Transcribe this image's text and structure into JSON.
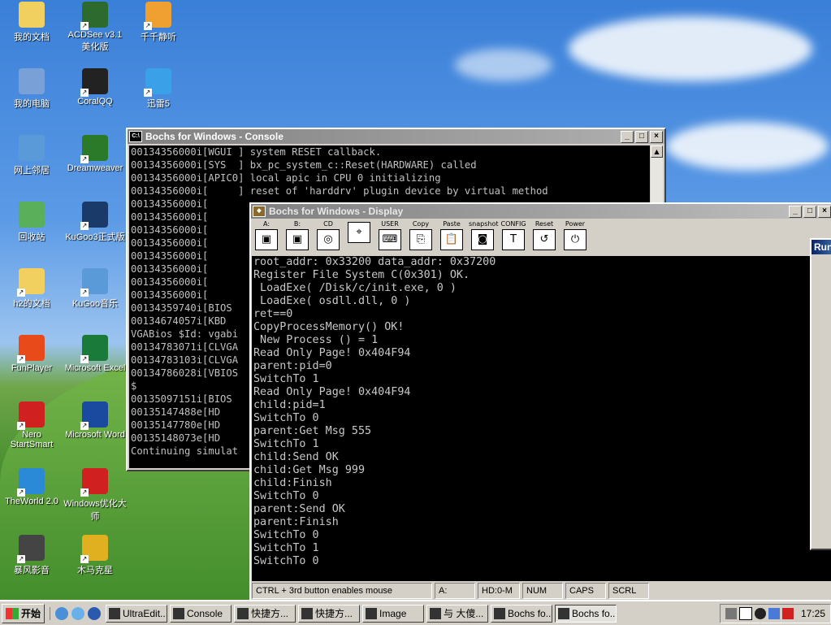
{
  "desktop": {
    "icons": [
      {
        "label": "我的文档",
        "icon": "my-documents-folder-icon",
        "color": "#f2d060"
      },
      {
        "label": "ACDSee v3.1 美化版",
        "icon": "acdsee-icon",
        "color": "#2d6a2d"
      },
      {
        "label": "千千静听",
        "icon": "ttplayer-icon",
        "color": "#f0a030"
      },
      {
        "label": "我的电脑",
        "icon": "my-computer-icon",
        "color": "#7aa0d8"
      },
      {
        "label": "CoralQQ",
        "icon": "qq-penguin-icon",
        "color": "#222222"
      },
      {
        "label": "迅雷5",
        "icon": "thunder-icon",
        "color": "#3aa0e8"
      },
      {
        "label": "网上邻居",
        "icon": "network-places-icon",
        "color": "#5a9ad8"
      },
      {
        "label": "Dreamweaver",
        "icon": "dreamweaver-icon",
        "color": "#2a7a2a"
      },
      {
        "label": "回收站",
        "icon": "recycle-bin-icon",
        "color": "#5ab05a"
      },
      {
        "label": "KuGoo3正式版",
        "icon": "kugoo-icon",
        "color": "#1a3a6a"
      },
      {
        "label": "h2的文档",
        "icon": "h2-documents-folder-icon",
        "color": "#f2d060"
      },
      {
        "label": "KuGoo音乐",
        "icon": "kugoo-music-icon",
        "color": "#5a9ad8"
      },
      {
        "label": "FunPlayer",
        "icon": "funplayer-icon",
        "color": "#e84a1a"
      },
      {
        "label": "Microsoft Excel",
        "icon": "excel-icon",
        "color": "#1a7a3a"
      },
      {
        "label": "Nero StartSmart",
        "icon": "nero-icon",
        "color": "#d02020"
      },
      {
        "label": "Microsoft Word",
        "icon": "word-icon",
        "color": "#1a4aa0"
      },
      {
        "label": "TheWorld 2.0",
        "icon": "theworld-browser-icon",
        "color": "#2a8ad8"
      },
      {
        "label": "Windows优化大师",
        "icon": "windows-optimizer-icon",
        "color": "#d02020"
      },
      {
        "label": "暴风影音",
        "icon": "storm-player-icon",
        "color": "#444444"
      },
      {
        "label": "木马克星",
        "icon": "trojan-killer-icon",
        "color": "#e0b020"
      }
    ]
  },
  "console": {
    "title": "Bochs for Windows - Console",
    "lines": [
      "00134356000i[WGUI ] system RESET callback.",
      "00134356000i[SYS  ] bx_pc_system_c::Reset(HARDWARE) called",
      "00134356000i[APIC0] local apic in CPU 0 initializing",
      "00134356000i[     ] reset of 'harddrv' plugin device by virtual method",
      "00134356000i[",
      "00134356000i[",
      "00134356000i[",
      "00134356000i[",
      "00134356000i[",
      "00134356000i[",
      "00134356000i[",
      "00134356000i[",
      "00134359740i[BIOS",
      "00134674057i[KBD",
      "VGABios $Id: vgabi",
      "00134783071i[CLVGA",
      "00134783103i[CLVGA",
      "00134786028i[VBIOS",
      "$",
      "00135097151i[BIOS",
      "00135147488e[HD",
      "00135147780e[HD",
      "00135148073e[HD",
      "Continuing simulat"
    ]
  },
  "display": {
    "title": "Bochs for Windows - Display",
    "toolbar": [
      {
        "label": "A:",
        "icon": "floppy-a-icon",
        "glyph": "▣"
      },
      {
        "label": "B:",
        "icon": "floppy-b-icon",
        "glyph": "▣"
      },
      {
        "label": "CD",
        "icon": "cdrom-icon",
        "glyph": "◎"
      },
      {
        "label": "",
        "icon": "mouse-icon",
        "glyph": "⌖"
      },
      {
        "label": "USER",
        "icon": "user-keyboard-icon",
        "glyph": "⌨"
      },
      {
        "label": "Copy",
        "icon": "copy-icon",
        "glyph": "⎘"
      },
      {
        "label": "Paste",
        "icon": "paste-icon",
        "glyph": "📋"
      },
      {
        "label": "snapshot",
        "icon": "snapshot-camera-icon",
        "glyph": "◙"
      },
      {
        "label": "CONFIG",
        "icon": "config-tools-icon",
        "glyph": "T"
      },
      {
        "label": "Reset",
        "icon": "reset-icon",
        "glyph": "↺"
      },
      {
        "label": "Power",
        "icon": "power-icon",
        "glyph": "⏻"
      }
    ],
    "screen_lines": [
      "root_addr: 0x33200 data_addr: 0x37200",
      "Register File System C(0x301) OK.",
      " LoadExe( /Disk/c/init.exe, 0 )",
      " LoadExe( osdll.dll, 0 )",
      "ret==0",
      "CopyProcessMemory() OK!",
      " New Process () = 1",
      "Read Only Page! 0x404F94",
      "parent:pid=0",
      "SwitchTo 1",
      "Read Only Page! 0x404F94",
      "child:pid=1",
      "SwitchTo 0",
      "parent:Get Msg 555",
      "SwitchTo 1",
      "child:Send OK",
      "child:Get Msg 999",
      "child:Finish",
      "SwitchTo 0",
      "parent:Send OK",
      "parent:Finish",
      "SwitchTo 0",
      "SwitchTo 1",
      "SwitchTo 0"
    ],
    "status": [
      "CTRL + 3rd button enables mouse",
      "A:",
      "HD:0-M",
      "NUM",
      "CAPS",
      "SCRL"
    ]
  },
  "run_window": {
    "title": "Run"
  },
  "taskbar": {
    "start_label": "开始",
    "tasks": [
      {
        "label": "UltraEdit...",
        "icon": "ultraedit-icon"
      },
      {
        "label": "Console",
        "icon": "console-icon"
      },
      {
        "label": "快捷方...",
        "icon": "shortcut-folder-icon"
      },
      {
        "label": "快捷方...",
        "icon": "shortcut-window-icon"
      },
      {
        "label": "Image",
        "icon": "folder-icon"
      },
      {
        "label": "与 大傻...",
        "icon": "chat-icon"
      },
      {
        "label": "Bochs fo...",
        "icon": "bochs-icon"
      },
      {
        "label": "Bochs fo...",
        "icon": "bochs-icon"
      }
    ],
    "clock": "17:25"
  }
}
